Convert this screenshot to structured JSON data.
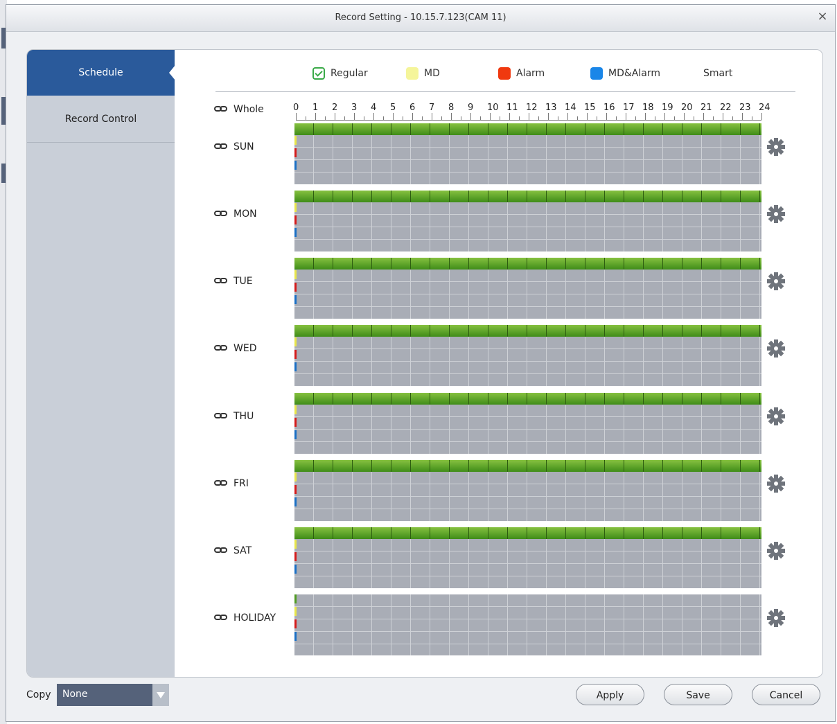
{
  "window": {
    "title": "Record Setting - 10.15.7.123(CAM 11)",
    "close_glyph": "×"
  },
  "sidebar": {
    "items": [
      {
        "label": "Schedule",
        "active": true
      },
      {
        "label": "Record Control",
        "active": false
      }
    ]
  },
  "legend": [
    {
      "label": "Regular",
      "color": "#3aaa48",
      "type": "checkbox",
      "checked": true
    },
    {
      "label": "MD",
      "color": "#f5f59a",
      "type": "swatch"
    },
    {
      "label": "Alarm",
      "color": "#f0390f",
      "type": "swatch"
    },
    {
      "label": "MD&Alarm",
      "color": "#1a86e8",
      "type": "swatch"
    },
    {
      "label": "Smart",
      "type": "text"
    }
  ],
  "schedule": {
    "whole_label": "Whole",
    "hours": [
      "0",
      "1",
      "2",
      "3",
      "4",
      "5",
      "6",
      "7",
      "8",
      "9",
      "10",
      "11",
      "12",
      "13",
      "14",
      "15",
      "16",
      "17",
      "18",
      "19",
      "20",
      "21",
      "22",
      "23",
      "24"
    ],
    "days": [
      {
        "label": "SUN",
        "regular_full_day": true
      },
      {
        "label": "MON",
        "regular_full_day": true
      },
      {
        "label": "TUE",
        "regular_full_day": true
      },
      {
        "label": "WED",
        "regular_full_day": true
      },
      {
        "label": "THU",
        "regular_full_day": true
      },
      {
        "label": "FRI",
        "regular_full_day": true
      },
      {
        "label": "SAT",
        "regular_full_day": true
      },
      {
        "label": "HOLIDAY",
        "regular_full_day": false
      }
    ],
    "colors": {
      "regular": "#4f9a22",
      "md": "#e8e64a",
      "alarm": "#d41a1a",
      "md_alarm": "#1a6fc4",
      "empty": "#a9adb6"
    }
  },
  "footer": {
    "copy_label": "Copy",
    "copy_value": "None",
    "apply": "Apply",
    "save": "Save",
    "cancel": "Cancel"
  },
  "accent": "#2a5a9b"
}
